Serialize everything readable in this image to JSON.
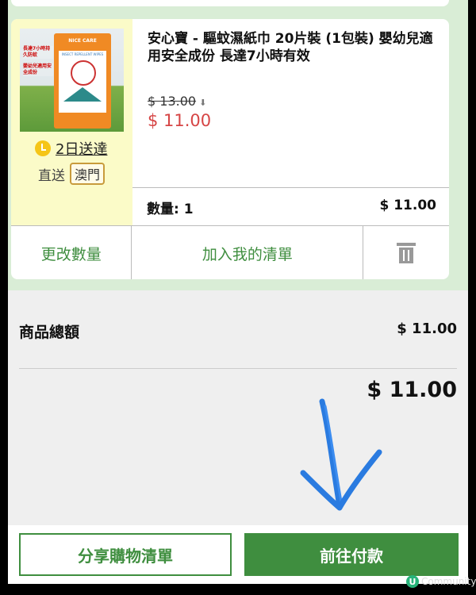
{
  "product": {
    "title": "安心寶 - 驅蚊濕紙巾 20片裝 (1包裝) 嬰幼兒適用安全成份 長達7小時有效",
    "original_price": "$ 13.00",
    "price": "$ 11.00",
    "delivery": "2日送達",
    "ship_label": "直送",
    "ship_region": "澳門",
    "pack_brand": "NICE CARE",
    "pack_sub": "INSECT REPELLENT WIPES",
    "pack_tags": [
      "長達7小時持久防蚊",
      "嬰幼兒適用安全成份"
    ],
    "quantity_label": "數量: 1",
    "line_total": "$ 11.00"
  },
  "actions": {
    "change_qty": "更改數量",
    "add_to_list": "加入我的清單"
  },
  "summary": {
    "subtotal_label": "商品總額",
    "subtotal_value": "$ 11.00",
    "grand_total": "$ 11.00"
  },
  "footer": {
    "share_label": "分享購物清單",
    "pay_label": "前往付款"
  },
  "watermark": {
    "text": "Community",
    "icon": "U"
  },
  "colors": {
    "accent": "#3f8e3f",
    "price_red": "#d64545",
    "annotation_arrow": "#2a7be0"
  }
}
